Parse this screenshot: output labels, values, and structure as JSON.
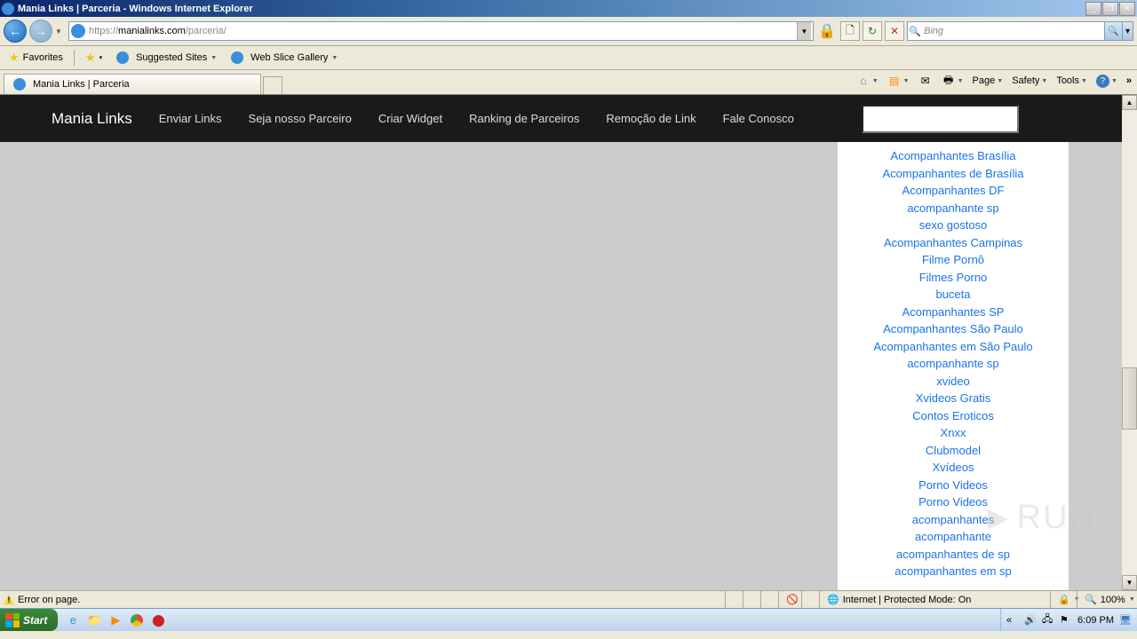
{
  "window": {
    "title": "Mania Links | Parceria - Windows Internet Explorer"
  },
  "nav": {
    "url_prefix": "https://",
    "url_host": "manialinks.com",
    "url_path": "/parceria/",
    "search_placeholder": "Bing"
  },
  "favorites": {
    "label": "Favorites",
    "suggested": "Suggested Sites",
    "webslice": "Web Slice Gallery"
  },
  "tab": {
    "title": "Mania Links | Parceria"
  },
  "cmdbar": {
    "page": "Page",
    "safety": "Safety",
    "tools": "Tools"
  },
  "site": {
    "brand": "Mania Links",
    "menu": [
      "Enviar Links",
      "Seja nosso Parceiro",
      "Criar Widget",
      "Ranking de Parceiros",
      "Remoção de Link",
      "Fale Conosco"
    ]
  },
  "sidebar_links": [
    "Acompanhantes Brasília",
    "Acompanhantes de Brasília",
    "Acompanhantes DF",
    "acompanhante sp",
    "sexo gostoso",
    "Acompanhantes Campinas",
    "Filme Pornô",
    "Filmes Porno",
    "buceta",
    "Acompanhantes SP",
    "Acompanhantes São Paulo",
    "Acompanhantes em São Paulo",
    "acompanhante sp",
    "xvideo",
    "Xvideos Gratis",
    "Contos Eroticos",
    "Xnxx",
    "Clubmodel",
    "Xvídeos",
    "Porno Videos",
    "Porno Videos",
    "acompanhantes",
    "acompanhante",
    "acompanhantes de sp",
    "acompanhantes em sp"
  ],
  "status": {
    "error": "Error on page.",
    "zone": "Internet | Protected Mode: On",
    "zoom": "100%"
  },
  "taskbar": {
    "start": "Start",
    "clock": "6:09 PM"
  },
  "watermark": "RUN"
}
